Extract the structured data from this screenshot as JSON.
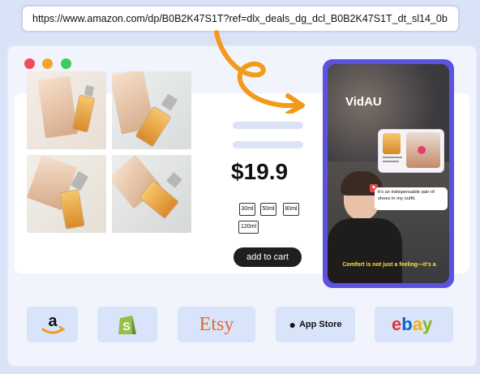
{
  "url": "https://www.amazon.com/dp/B0B2K47S1T?ref=dlx_deals_dg_dcl_B0B2K47S1T_dt_sl14_0b",
  "product": {
    "price": "$19.9",
    "sizes": [
      "30ml",
      "50ml",
      "80ml",
      "120ml"
    ],
    "add_to_cart": "add to cart"
  },
  "video": {
    "logo": "VidAU",
    "bubble_text": "it’s an indispensable pair of shoes in my outfit.",
    "caption": "Comfort is not just a feeling—it’s a"
  },
  "stores": {
    "etsy": "Etsy",
    "appstore": "App Store",
    "ebay": "ebay"
  },
  "colors": {
    "accent": "#5b53e0",
    "arrow": "#f39a1b"
  }
}
